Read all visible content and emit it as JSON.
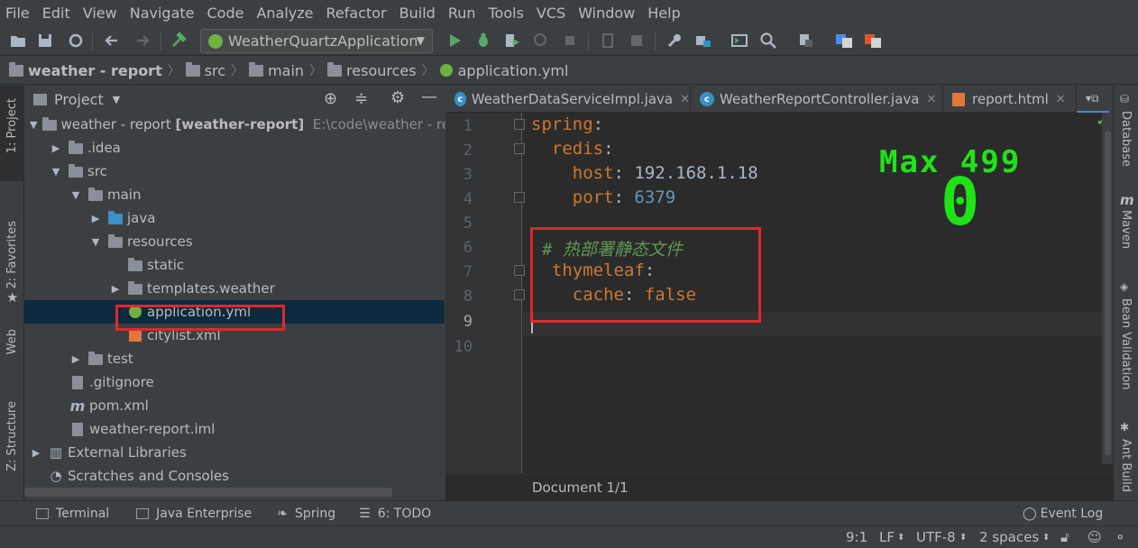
{
  "menu": [
    "File",
    "Edit",
    "View",
    "Navigate",
    "Code",
    "Analyze",
    "Refactor",
    "Build",
    "Run",
    "Tools",
    "VCS",
    "Window",
    "Help"
  ],
  "toolbar": {
    "run_config": "WeatherQuartzApplication"
  },
  "breadcrumb": [
    "weather - report",
    "src",
    "main",
    "resources",
    "application.yml"
  ],
  "left_strip": {
    "project": "1: Project",
    "favorites": "2: Favorites",
    "web": "Web",
    "structure": "Z: Structure"
  },
  "project_panel": {
    "title": "Project",
    "tree": [
      {
        "label": "weather - report",
        "bold": "[weather-report]",
        "path": "E:\\code\\weather - rep"
      },
      {
        "label": ".idea"
      },
      {
        "label": "src"
      },
      {
        "label": "main"
      },
      {
        "label": "java"
      },
      {
        "label": "resources"
      },
      {
        "label": "static"
      },
      {
        "label": "templates.weather"
      },
      {
        "label": "application.yml"
      },
      {
        "label": "citylist.xml"
      },
      {
        "label": "test"
      },
      {
        "label": ".gitignore"
      },
      {
        "label": "pom.xml"
      },
      {
        "label": "weather-report.iml"
      },
      {
        "label": "External Libraries"
      },
      {
        "label": "Scratches and Consoles"
      }
    ]
  },
  "tabs": [
    "WeatherDataServiceImpl.java",
    "WeatherReportController.java",
    "report.html"
  ],
  "editor": {
    "line_numbers": [
      "1",
      "2",
      "3",
      "4",
      "5",
      "6",
      "7",
      "8",
      "9",
      "10"
    ],
    "lines": {
      "l1_key": "spring",
      "l1_colon": ":",
      "l2_key": "redis",
      "l2_colon": ":",
      "l3_key": "host",
      "l3_colon": ": ",
      "l3_val": "192.168.1.18",
      "l4_key": "port",
      "l4_colon": ": ",
      "l4_val": "6379",
      "l6_comment": "# 热部署静态文件",
      "l7_key": "thymeleaf",
      "l7_colon": ":",
      "l8_key": "cache",
      "l8_colon": ": ",
      "l8_val": "false"
    },
    "status": "Document 1/1"
  },
  "overlay": {
    "max_label": "Max 499",
    "count": "0"
  },
  "right_strip": {
    "database": "Database",
    "maven": "Maven",
    "bean": "Bean Validation",
    "ant": "Ant Build"
  },
  "bottom_tools": {
    "terminal": "Terminal",
    "java_ee": "Java Enterprise",
    "spring": "Spring",
    "todo": "6: TODO",
    "event_log": "Event Log"
  },
  "status": {
    "position": "9:1",
    "line_sep": "LF",
    "encoding": "UTF-8",
    "indent": "2 spaces"
  },
  "colors": {
    "keyword": "#cc7832",
    "number": "#6897bb",
    "comment": "#629755",
    "overlay": "#1fe316",
    "highlight_box": "#e0282e"
  }
}
